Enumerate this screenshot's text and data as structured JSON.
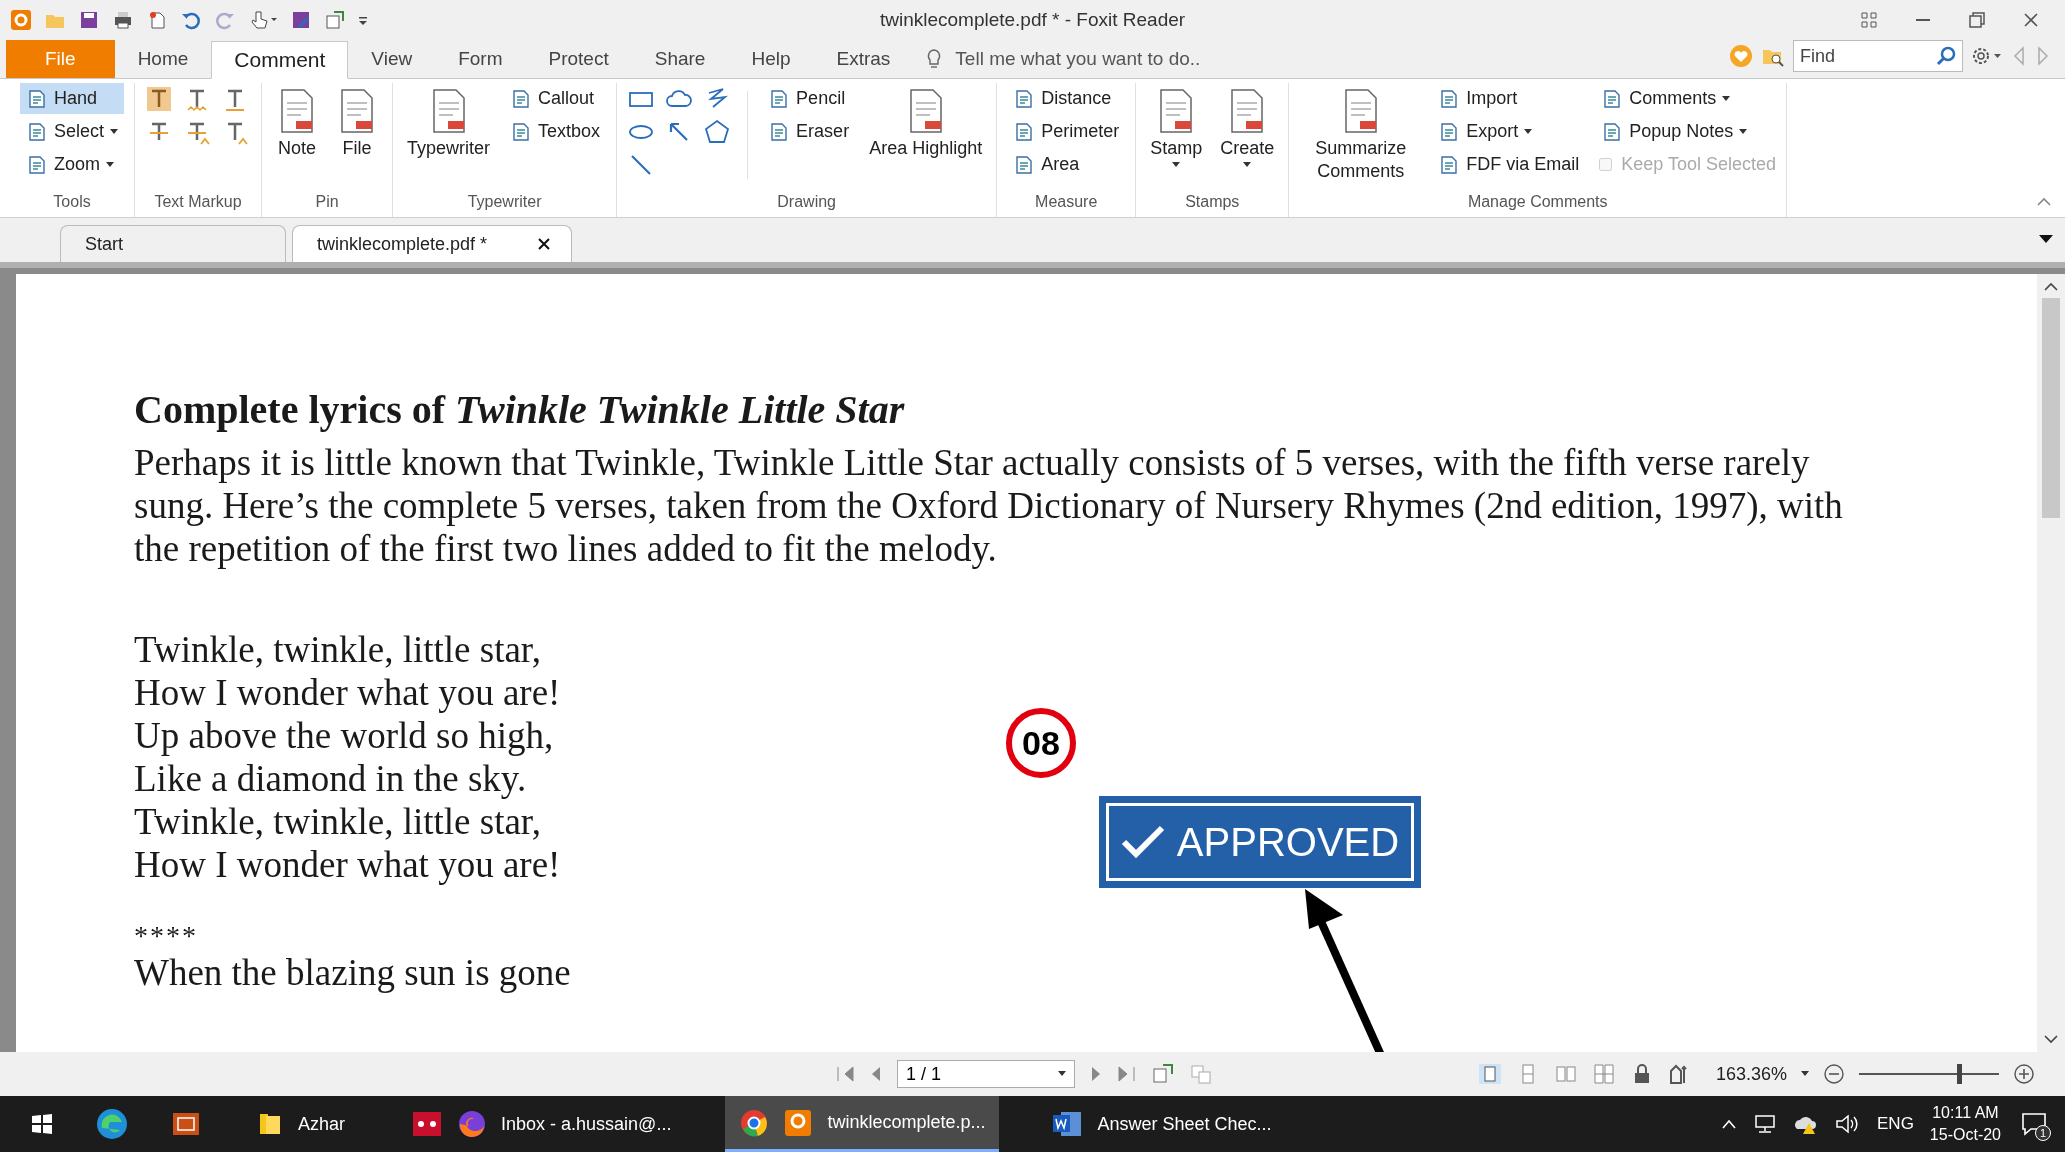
{
  "window": {
    "title": "twinklecomplete.pdf * - Foxit Reader"
  },
  "menu_tabs": [
    {
      "label": "File",
      "kind": "file",
      "selected": false
    },
    {
      "label": "Home",
      "kind": "tab",
      "selected": false
    },
    {
      "label": "Comment",
      "kind": "tab",
      "selected": true
    },
    {
      "label": "View",
      "kind": "tab",
      "selected": false
    },
    {
      "label": "Form",
      "kind": "tab",
      "selected": false
    },
    {
      "label": "Protect",
      "kind": "tab",
      "selected": false
    },
    {
      "label": "Share",
      "kind": "tab",
      "selected": false
    },
    {
      "label": "Help",
      "kind": "tab",
      "selected": false
    },
    {
      "label": "Extras",
      "kind": "tab",
      "selected": false
    }
  ],
  "tell_me": {
    "placeholder": "Tell me what you want to do.."
  },
  "find": {
    "placeholder": "Find"
  },
  "ribbon": {
    "groups": [
      {
        "label": "Tools",
        "kind": "plain",
        "columns": [
          [
            {
              "kind": "small",
              "label": "Hand",
              "selected": true,
              "dropdown": false
            },
            {
              "kind": "small",
              "label": "Select",
              "selected": false,
              "dropdown": true
            },
            {
              "kind": "small",
              "label": "Zoom",
              "selected": false,
              "dropdown": true
            }
          ]
        ]
      },
      {
        "label": "Text Markup",
        "kind": "markup"
      },
      {
        "label": "Pin",
        "kind": "plain",
        "columns": [
          [
            {
              "kind": "large",
              "label": "Note",
              "dropdown": false
            }
          ],
          [
            {
              "kind": "large",
              "label": "File",
              "dropdown": false
            }
          ]
        ]
      },
      {
        "label": "Typewriter",
        "kind": "plain",
        "columns": [
          [
            {
              "kind": "large",
              "label": "Typewriter",
              "dropdown": false
            }
          ],
          [
            {
              "kind": "small",
              "label": "Callout",
              "dropdown": false
            },
            {
              "kind": "small",
              "label": "Textbox",
              "dropdown": false
            }
          ]
        ]
      },
      {
        "label": "Drawing",
        "kind": "drawing",
        "columns": [
          [
            {
              "kind": "small",
              "label": "Pencil",
              "dropdown": false
            },
            {
              "kind": "small",
              "label": "Eraser",
              "dropdown": false
            }
          ],
          [
            {
              "kind": "large",
              "label": "Area Highlight",
              "dropdown": false
            }
          ]
        ]
      },
      {
        "label": "Measure",
        "kind": "plain",
        "columns": [
          [
            {
              "kind": "small",
              "label": "Distance",
              "dropdown": false
            },
            {
              "kind": "small",
              "label": "Perimeter",
              "dropdown": false
            },
            {
              "kind": "small",
              "label": "Area",
              "dropdown": false
            }
          ]
        ]
      },
      {
        "label": "Stamps",
        "kind": "plain",
        "columns": [
          [
            {
              "kind": "large",
              "label": "Stamp",
              "dropdown": true
            }
          ],
          [
            {
              "kind": "large",
              "label": "Create",
              "dropdown": true
            }
          ]
        ]
      },
      {
        "label": "Manage Comments",
        "kind": "plain",
        "columns": [
          [
            {
              "kind": "large",
              "label": "Summarize Comments",
              "dropdown": false
            }
          ],
          [
            {
              "kind": "small",
              "label": "Import",
              "dropdown": false
            },
            {
              "kind": "small",
              "label": "Export",
              "dropdown": true
            },
            {
              "kind": "small",
              "label": "FDF via Email",
              "dropdown": false
            }
          ],
          [
            {
              "kind": "small",
              "label": "Comments",
              "dropdown": true
            },
            {
              "kind": "small",
              "label": "Popup Notes",
              "dropdown": true
            },
            {
              "kind": "checkbox",
              "label": "Keep Tool Selected",
              "checked": false,
              "disabled": true
            }
          ]
        ]
      }
    ]
  },
  "doc_tabs": [
    {
      "label": "Start",
      "closable": false,
      "selected": false
    },
    {
      "label": "twinklecomplete.pdf *",
      "closable": true,
      "selected": true
    }
  ],
  "document": {
    "heading": "Complete lyrics of *Twinkle Twinkle Little Star*",
    "intro": "Perhaps it is little known that Twinkle, Twinkle Little Star actually consists of 5 verses, with the fifth verse rarely sung. Here’s the complete 5 verses, taken from the Oxford Dictionary of Nursery Rhymes (2nd edition, 1997), with the repetition of the first two lines added to fit the melody.",
    "verse": [
      "Twinkle, twinkle, little star,",
      "How I wonder what you are!",
      "Up above the world so high,",
      "Like a diamond in the sky.",
      "Twinkle, twinkle, little star,",
      "How I wonder what you are!"
    ],
    "separator": "****",
    "next_line": "When the blazing sun is gone"
  },
  "annotations": {
    "number_badge": "08",
    "stamp": "APPROVED"
  },
  "status_bar": {
    "page": "1 / 1",
    "zoom": "163.36%",
    "zoom_slider": {
      "level": 0.7
    }
  },
  "taskbar": {
    "items": [
      {
        "label": "Azhar",
        "kind": "folder",
        "selected": false
      },
      {
        "label": "Inbox - a.hussain@...",
        "kind": "browser",
        "selected": false
      },
      {
        "label": "twinklecomplete.p...",
        "kind": "reader",
        "selected": true
      },
      {
        "label": "Answer Sheet Chec...",
        "kind": "word",
        "selected": false
      }
    ],
    "language": "ENG",
    "time": "10:11 AM",
    "date": "15-Oct-20",
    "notifications": "1"
  }
}
